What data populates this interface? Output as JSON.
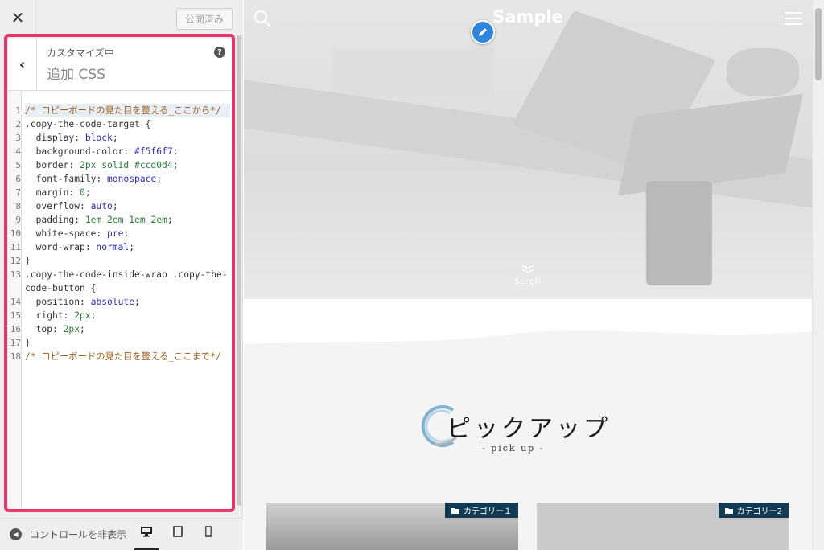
{
  "sidebar": {
    "close_glyph": "✕",
    "publish_label": "公開済み",
    "section_sub": "カスタマイズ中",
    "section_title": "追加 CSS",
    "back_glyph": "‹",
    "help_glyph": "?",
    "footer_toggle": "コントロールを非表示",
    "devices": [
      "desktop-icon",
      "tablet-icon",
      "mobile-icon"
    ]
  },
  "css_editor": {
    "lines": [
      {
        "n": "1",
        "t": "/* コピーボードの見た目を整える_ここから*/"
      },
      {
        "n": "2",
        "t": ".copy-the-code-target {"
      },
      {
        "n": "3",
        "p": "  display: ",
        "v": "block",
        "e": ";"
      },
      {
        "n": "4",
        "p": "  background-color: ",
        "v": "#f5f6f7",
        "e": ";"
      },
      {
        "n": "5",
        "p": "  border: ",
        "v": "2px solid #ccd0d4",
        "e": ";"
      },
      {
        "n": "6",
        "p": "  font-family: ",
        "v": "monospace",
        "e": ";"
      },
      {
        "n": "7",
        "p": "  margin: ",
        "v": "0",
        "e": ";"
      },
      {
        "n": "8",
        "p": "  overflow: ",
        "v": "auto",
        "e": ";"
      },
      {
        "n": "9",
        "p": "  padding: ",
        "v": "1em 2em 1em 2em",
        "e": ";"
      },
      {
        "n": "10",
        "p": "  white-space: ",
        "v": "pre",
        "e": ";"
      },
      {
        "n": "11",
        "p": "  word-wrap: ",
        "v": "normal",
        "e": ";"
      },
      {
        "n": "12",
        "t": "}"
      },
      {
        "n": "13",
        "t": ".copy-the-code-inside-wrap .copy-the-code-button {"
      },
      {
        "n": "14",
        "p": "  position: ",
        "v": "absolute",
        "e": ";"
      },
      {
        "n": "15",
        "p": "  right: ",
        "v": "2px",
        "e": ";"
      },
      {
        "n": "16",
        "p": "  top: ",
        "v": "2px",
        "e": ";"
      },
      {
        "n": "17",
        "t": "}"
      },
      {
        "n": "18",
        "t": "/* コピーボードの見た目を整える_ここまで*/"
      }
    ]
  },
  "preview": {
    "site_title": "Sample",
    "scroll_label": "Scroll",
    "pickup_title": "ピックアップ",
    "pickup_sub": "- pick up -",
    "cards": [
      {
        "category": "カテゴリー１"
      },
      {
        "category": "カテゴリー2"
      }
    ]
  },
  "colors": {
    "focus_frame": "#e8336b",
    "edit_button": "#2e86de",
    "category_badge": "#123a52",
    "css_comment": "#a0601b",
    "css_value": "#2c2cb4"
  }
}
